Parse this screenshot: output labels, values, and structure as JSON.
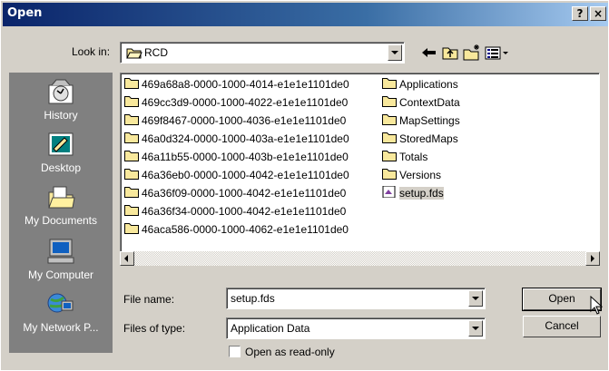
{
  "window": {
    "title": "Open",
    "help_button": "?",
    "close_button": "×"
  },
  "look_in": {
    "label": "Look in:",
    "value": "RCD"
  },
  "places": [
    {
      "label": "History",
      "icon": "history-icon"
    },
    {
      "label": "Desktop",
      "icon": "desktop-icon"
    },
    {
      "label": "My Documents",
      "icon": "my-documents-icon"
    },
    {
      "label": "My Computer",
      "icon": "my-computer-icon"
    },
    {
      "label": "My Network P...",
      "icon": "network-places-icon"
    }
  ],
  "files": {
    "column1": [
      "469a68a8-0000-1000-4014-e1e1e1101de0",
      "469cc3d9-0000-1000-4022-e1e1e1101de0",
      "469f8467-0000-1000-4036-e1e1e1101de0",
      "46a0d324-0000-1000-403a-e1e1e1101de0",
      "46a11b55-0000-1000-403b-e1e1e1101de0",
      "46a36eb0-0000-1000-4042-e1e1e1101de0",
      "46a36f09-0000-1000-4042-e1e1e1101de0",
      "46a36f34-0000-1000-4042-e1e1e1101de0",
      "46aca586-0000-1000-4062-e1e1e1101de0"
    ],
    "column2": [
      "Applications",
      "ContextData",
      "MapSettings",
      "StoredMaps",
      "Totals",
      "Versions"
    ],
    "selected_file": "setup.fds"
  },
  "file_name": {
    "label": "File name:",
    "value": "setup.fds"
  },
  "files_of_type": {
    "label": "Files of type:",
    "value": "Application Data"
  },
  "read_only": {
    "label": "Open as read-only",
    "checked": false
  },
  "buttons": {
    "open": "Open",
    "cancel": "Cancel"
  }
}
